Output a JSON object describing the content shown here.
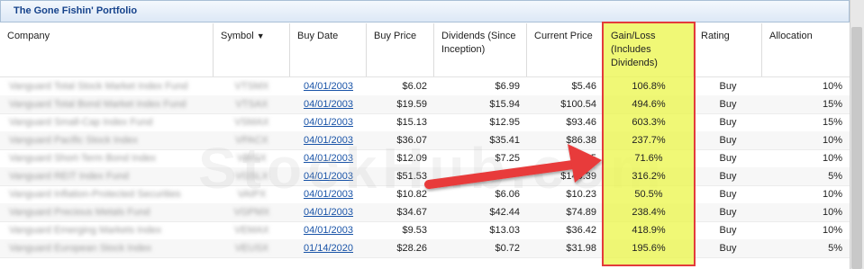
{
  "panel": {
    "title": "The Gone Fishin' Portfolio"
  },
  "columns": [
    "Company",
    "Symbol",
    "Buy Date",
    "Buy Price",
    "Dividends (Since Inception)",
    "Current Price",
    "Gain/Loss (Includes Dividends)",
    "Rating",
    "Allocation"
  ],
  "sort_icon": "sort-down-arrow",
  "rows": [
    {
      "company": "Vanguard Total Stock Market Index Fund",
      "symbol": "VTSMX",
      "buy_date": "04/01/2003",
      "buy_price": "$6.02",
      "dividends": "$6.99",
      "current_price": "$5.46",
      "gain": "106.8%",
      "rating": "Buy",
      "allocation": "10%"
    },
    {
      "company": "Vanguard Total Bond Market Index Fund",
      "symbol": "VTSAX",
      "buy_date": "04/01/2003",
      "buy_price": "$19.59",
      "dividends": "$15.94",
      "current_price": "$100.54",
      "gain": "494.6%",
      "rating": "Buy",
      "allocation": "15%"
    },
    {
      "company": "Vanguard Small-Cap Index Fund",
      "symbol": "VSMAX",
      "buy_date": "04/01/2003",
      "buy_price": "$15.13",
      "dividends": "$12.95",
      "current_price": "$93.46",
      "gain": "603.3%",
      "rating": "Buy",
      "allocation": "15%"
    },
    {
      "company": "Vanguard Pacific Stock Index",
      "symbol": "VPACX",
      "buy_date": "04/01/2003",
      "buy_price": "$36.07",
      "dividends": "$35.41",
      "current_price": "$86.38",
      "gain": "237.7%",
      "rating": "Buy",
      "allocation": "10%"
    },
    {
      "company": "Vanguard Short-Term Bond Index",
      "symbol": "VBISX",
      "buy_date": "04/01/2003",
      "buy_price": "$12.09",
      "dividends": "$7.25",
      "current_price": "$13.5",
      "gain": "71.6%",
      "rating": "Buy",
      "allocation": "10%"
    },
    {
      "company": "Vanguard REIT Index Fund",
      "symbol": "VGSLX",
      "buy_date": "04/01/2003",
      "buy_price": "$51.53",
      "dividends": "",
      "current_price": "$140.39",
      "gain": "316.2%",
      "rating": "Buy",
      "allocation": "5%"
    },
    {
      "company": "Vanguard Inflation-Protected Securities",
      "symbol": "VAIPX",
      "buy_date": "04/01/2003",
      "buy_price": "$10.82",
      "dividends": "$6.06",
      "current_price": "$10.23",
      "gain": "50.5%",
      "rating": "Buy",
      "allocation": "10%"
    },
    {
      "company": "Vanguard Precious Metals Fund",
      "symbol": "VGPMX",
      "buy_date": "04/01/2003",
      "buy_price": "$34.67",
      "dividends": "$42.44",
      "current_price": "$74.89",
      "gain": "238.4%",
      "rating": "Buy",
      "allocation": "10%"
    },
    {
      "company": "Vanguard Emerging Markets Index",
      "symbol": "VEMAX",
      "buy_date": "04/01/2003",
      "buy_price": "$9.53",
      "dividends": "$13.03",
      "current_price": "$36.42",
      "gain": "418.9%",
      "rating": "Buy",
      "allocation": "10%"
    },
    {
      "company": "Vanguard European Stock Index",
      "symbol": "VEUSX",
      "buy_date": "01/14/2020",
      "buy_price": "$28.26",
      "dividends": "$0.72",
      "current_price": "$31.98",
      "gain": "195.6%",
      "rating": "Buy",
      "allocation": "5%"
    }
  ],
  "colors": {
    "highlight_fill": "#ecf650",
    "highlight_border": "#e33b3b",
    "arrow": "#e83a3a",
    "link": "#1a54a8",
    "header_title": "#15428b"
  }
}
